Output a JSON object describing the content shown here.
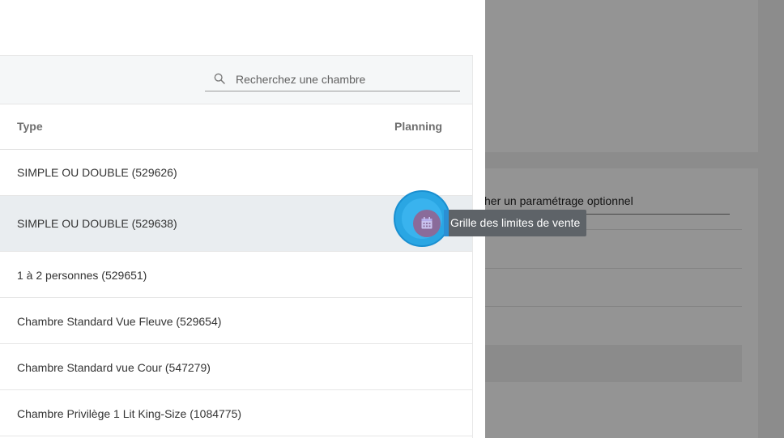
{
  "background": {
    "search_placeholder_fragment": "her un paramétrage optionnel"
  },
  "panel": {
    "search": {
      "placeholder": "Recherchez une chambre",
      "value": ""
    },
    "table": {
      "headers": {
        "type": "Type",
        "planning": "Planning"
      },
      "rows": [
        {
          "type": "SIMPLE OU DOUBLE (529626)"
        },
        {
          "type": "SIMPLE OU DOUBLE (529638)"
        },
        {
          "type": "1 à 2 personnes (529651)"
        },
        {
          "type": "Chambre Standard Vue Fleuve (529654)"
        },
        {
          "type": "Chambre Standard vue Cour (547279)"
        },
        {
          "type": "Chambre Privilège 1 Lit King-Size (1084775)"
        }
      ]
    },
    "tooltip": "Grille des limites de vente"
  },
  "colors": {
    "accent": "#2aa6e3",
    "planning_button": "#8a6b9a",
    "tooltip_bg": "#5e6368",
    "row_hover": "#e9edf0"
  },
  "icons": {
    "search": "search-icon",
    "planning": "calendar-icon"
  }
}
